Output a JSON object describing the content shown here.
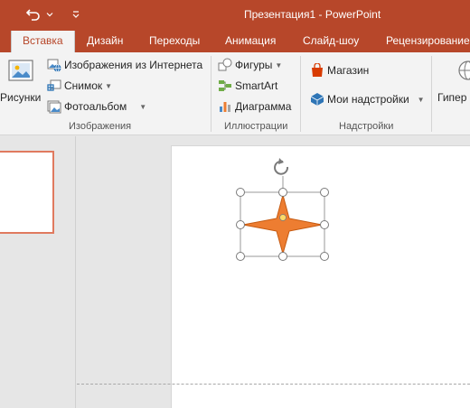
{
  "window": {
    "title": "Презентация1 - PowerPoint"
  },
  "quick_access": {
    "undo_icon": "undo-icon",
    "dropdown_icon": "chevron-down-icon",
    "customize_icon": "customize-icon"
  },
  "tabs": [
    {
      "label": "Вставка",
      "active": true
    },
    {
      "label": "Дизайн"
    },
    {
      "label": "Переходы"
    },
    {
      "label": "Анимация"
    },
    {
      "label": "Слайд-шоу"
    },
    {
      "label": "Рецензирование"
    }
  ],
  "ribbon": {
    "images_group": {
      "pictures_label": "Рисунки",
      "online_pictures_label": "Изображения из Интернета",
      "screenshot_label": "Снимок",
      "photo_album_label": "Фотоальбом",
      "group_label": "Изображения"
    },
    "illustrations_group": {
      "shapes_label": "Фигуры",
      "smartart_label": "SmartArt",
      "chart_label": "Диаграмма",
      "group_label": "Иллюстрации"
    },
    "addins_group": {
      "store_label": "Магазин",
      "my_addins_label": "Мои надстройки",
      "group_label": "Надстройки"
    },
    "links_group": {
      "hyperlink_label": "Гипер"
    }
  },
  "colors": {
    "accent": "#b7472a",
    "shape_fill": "#ed7d31",
    "shape_stroke": "#c55a11",
    "thumb_border": "#e07a5f"
  },
  "slide": {
    "selected_shape": "star-4-point"
  }
}
